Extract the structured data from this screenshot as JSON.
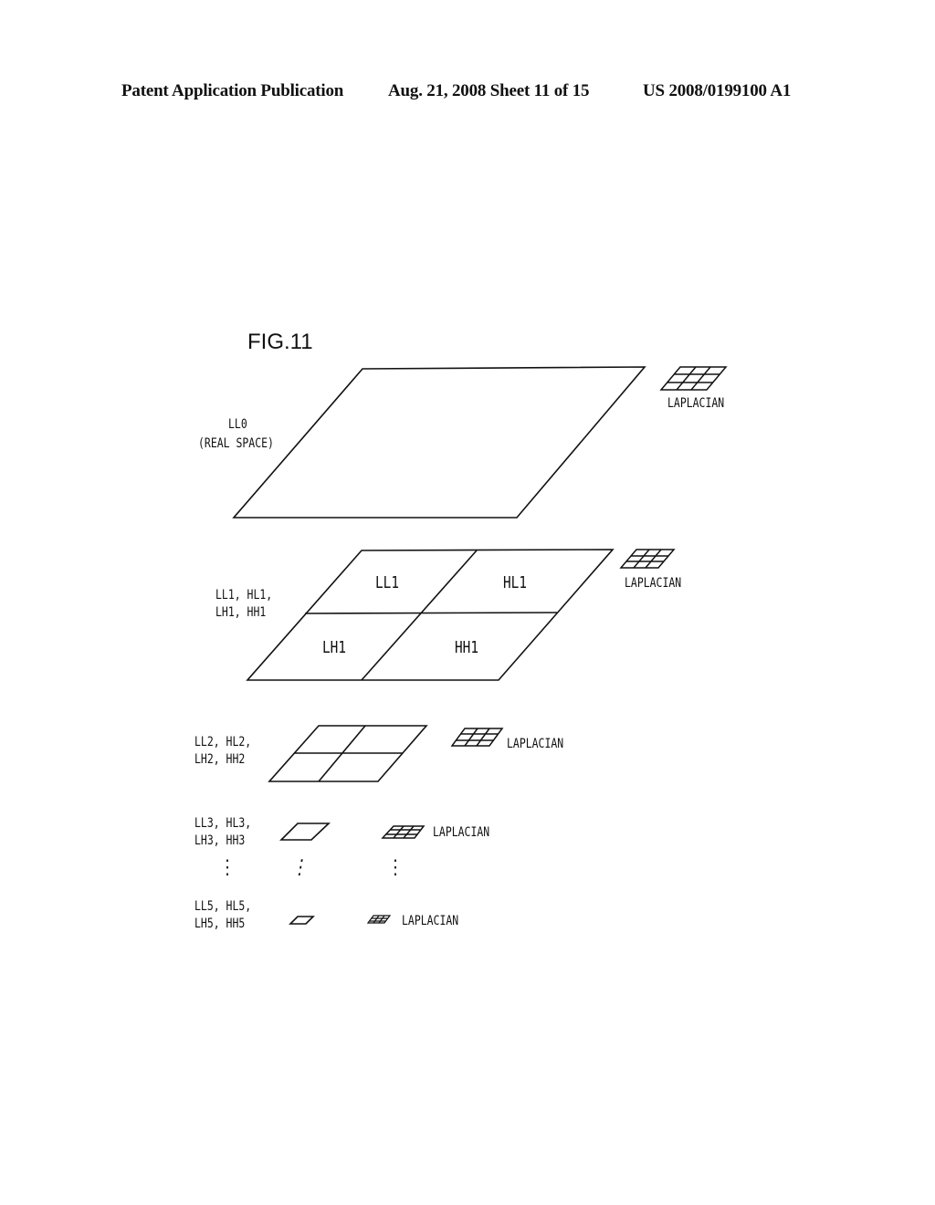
{
  "header": {
    "publication": "Patent Application Publication",
    "date_sheet": "Aug. 21, 2008  Sheet 11 of 15",
    "number": "US 2008/0199100 A1"
  },
  "figure": {
    "title": "FIG.11",
    "levels": [
      {
        "id": "level-0",
        "label_line1": "LL0",
        "label_line2": "(REAL SPACE)",
        "laplacian": "LAPLACIAN",
        "subbands": []
      },
      {
        "id": "level-1",
        "label_line1": "LL1, HL1,",
        "label_line2": "LH1, HH1",
        "laplacian": "LAPLACIAN",
        "subbands": [
          "LL1",
          "HL1",
          "LH1",
          "HH1"
        ]
      },
      {
        "id": "level-2",
        "label_line1": "LL2, HL2,",
        "label_line2": "LH2, HH2",
        "laplacian": "LAPLACIAN",
        "subbands": []
      },
      {
        "id": "level-3",
        "label_line1": "LL3, HL3,",
        "label_line2": "LH3, HH3",
        "laplacian": "LAPLACIAN",
        "subbands": []
      },
      {
        "id": "level-5",
        "label_line1": "LL5, HL5,",
        "label_line2": "LH5, HH5",
        "laplacian": "LAPLACIAN",
        "subbands": []
      }
    ],
    "ellipsis": "⋮"
  },
  "colors": {
    "ink": "#111111",
    "paper": "#ffffff"
  }
}
